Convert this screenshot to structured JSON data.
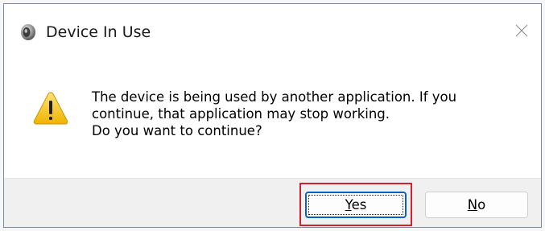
{
  "window": {
    "title": "Device In Use",
    "app_icon": "speaker-icon",
    "close_icon": "close-icon"
  },
  "content": {
    "icon": "warning-icon",
    "message_lines": [
      "The device is being used by another application.  If you",
      "continue, that application may stop working.",
      "Do you want to continue?"
    ]
  },
  "buttons": {
    "yes": {
      "access_key": "Y",
      "rest": "es"
    },
    "no": {
      "access_key": "N",
      "rest": "o"
    }
  },
  "colors": {
    "accent": "#0a5fc4",
    "highlight": "#d2202e",
    "warning": "#f4c21a"
  }
}
